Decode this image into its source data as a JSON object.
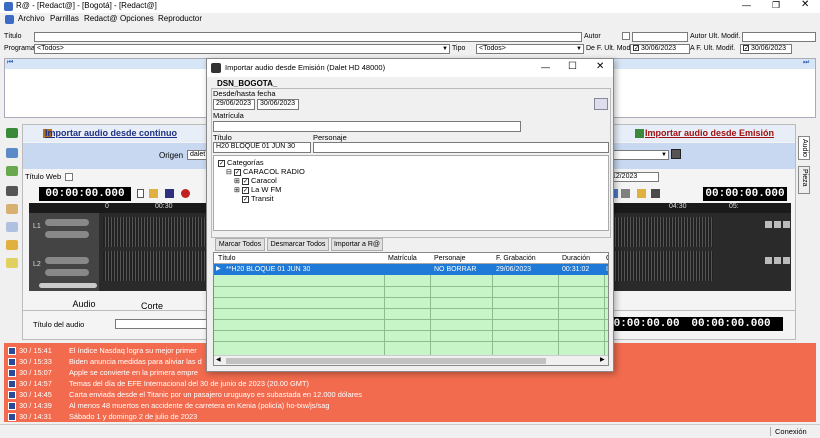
{
  "window": {
    "title": "R@ - [Redact@] - [Bogotá] - [Redact@]"
  },
  "menu": [
    "Archivo",
    "Parrillas",
    "Redact@",
    "Opciones",
    "Reproductor"
  ],
  "filters": {
    "titulo_label": "Título",
    "autor_label": "Autor",
    "autor_ult_label": "Autor Ult. Modif.",
    "programa_label": "Programa",
    "programa_value": "<Todos>",
    "tipo_label": "Tipo",
    "tipo_value": "<Todos>",
    "de_label": "De F. Ult. Modif.",
    "de_value": "30/06/2023",
    "a_label": "A F. Ult. Modif.",
    "a_value": "30/06/2023"
  },
  "panel": {
    "import_continuo": "Importar audio desde continuo",
    "import_emision": "Importar audio desde Emisión",
    "origen_label": "Origen",
    "origen_value": "dalet",
    "titulo_web_label": "Título Web",
    "date_right": "/12/2023",
    "timer_left": "00:00:00.000",
    "timer_right": "00:00:00.000",
    "timer_bottom_1": "00:00:00.000",
    "timer_bottom_2": "00:00:00.000",
    "ruler_left": [
      "0",
      "00:30"
    ],
    "ruler_right": [
      "04:30",
      "05:"
    ],
    "tab_audio": "Audio",
    "tab_corte": "Corte",
    "titulo_audio_label": "Título del audio",
    "side_tab_audio": "Audio",
    "side_tab_pieza": "Pieza",
    "track_labels": [
      "L1",
      "L2"
    ]
  },
  "dialog": {
    "title": "Importar audio desde Emisión (Dalet HD 48000)",
    "station": "DSN_BOGOTA_",
    "desde_label": "Desde/hasta fecha",
    "desde_value": "29/06/2023",
    "hasta_value": "30/06/2023",
    "matricula_label": "Matrícula",
    "titulo_label": "Título",
    "titulo_value": "H20 BLOQUE 01 JUN 30",
    "personaje_label": "Personaje",
    "tree": {
      "root": "Categorías",
      "group": "CARACOL RADIO",
      "children": [
        "Caracol",
        "La W FM",
        "Transit"
      ]
    },
    "buttons": {
      "marcar": "Marcar Todos",
      "desmarcar": "Desmarcar Todos",
      "importar": "Importar a R@"
    },
    "table": {
      "headers": [
        "Título",
        "Matrícula",
        "Personaje",
        "F. Grabación",
        "Duración",
        "C"
      ],
      "rows": [
        [
          "**H20 BLOQUE 01 JUN 30",
          "",
          "NO BORRAR",
          "29/06/2023",
          "00:31:02",
          "I"
        ]
      ]
    }
  },
  "news": [
    {
      "time": "30 / 15:41",
      "text": "El índice Nasdaq logra su mejor primer"
    },
    {
      "time": "30 / 15:33",
      "text": "Biden anuncia medidas para aliviar las d"
    },
    {
      "time": "30 / 15:07",
      "text": "Apple se convierte en la primera empre"
    },
    {
      "time": "30 / 14:57",
      "text": "Temas del día de EFE Internacional del 30 de junio de 2023 (20.00 GMT)"
    },
    {
      "time": "30 / 14:45",
      "text": "Carta enviada desde el Titanic por un pasajero uruguayo es subastada en 12.000 dólares"
    },
    {
      "time": "30 / 14:39",
      "text": "Al menos 48 muertos en accidente de carretera en Kenia (policía) ho-txw/js/sag"
    },
    {
      "time": "30 / 14:31",
      "text": "Sábado 1 y domingo 2 de julio de 2023"
    }
  ],
  "status": {
    "conexion": "Conexión"
  },
  "colors": {
    "news_bg": "#f26b4e",
    "grid_bg": "#c8f5c8",
    "selected_row": "#1e7ad6",
    "header_blue": "#d6e6f6"
  }
}
